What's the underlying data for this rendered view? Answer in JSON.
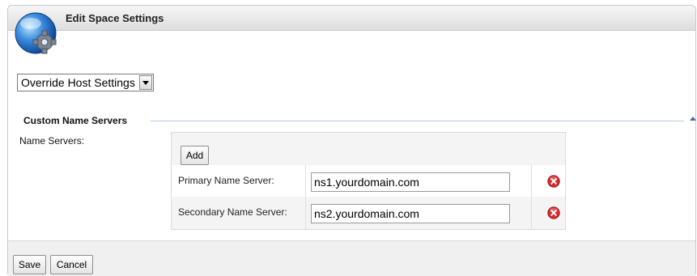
{
  "header": {
    "title": "Edit Space Settings",
    "icon": "settings-globe-icon"
  },
  "mode_select": {
    "selected": "Override Host Settings"
  },
  "section": {
    "title": "Custom Name Servers"
  },
  "name_servers": {
    "label": "Name Servers:",
    "add_label": "Add",
    "rows": [
      {
        "label": "Primary Name Server:",
        "value": "ns1.yourdomain.com"
      },
      {
        "label": "Secondary Name Server:",
        "value": "ns2.yourdomain.com"
      }
    ]
  },
  "footer": {
    "save_label": "Save",
    "cancel_label": "Cancel"
  },
  "colors": {
    "accent": "#3f6fa6",
    "delete": "#d9282c",
    "section_rule": "#b9cde2"
  }
}
